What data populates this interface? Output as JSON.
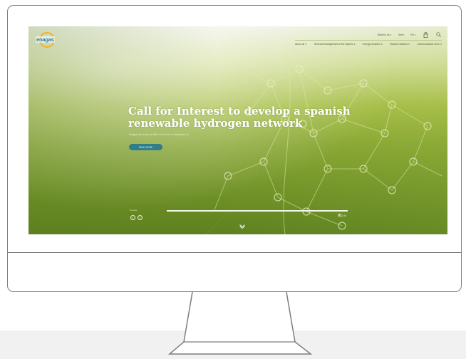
{
  "site": {
    "logo_text": "enagas"
  },
  "topbar": {
    "items": [
      "Work for Us ∨",
      "Get in",
      "EN ∨"
    ],
    "icons": [
      "user-icon",
      "search-icon"
    ]
  },
  "mainnav": {
    "items": [
      "About us ∨",
      "Technical Management of the System ∨",
      "Energy transition ∨",
      "Investor relations ∨",
      "Communication room ∨"
    ]
  },
  "hero": {
    "title": "Call for Interest to develop a spanish renewable hydrogen network",
    "subtitle": "Enagas will launch an NBO on the 2nd of September 2x",
    "button": "READ MORE"
  },
  "slider": {
    "label": "Enagas",
    "current": "01",
    "total": "/ 04"
  },
  "colors": {
    "hero_green": "#86a532",
    "button_teal": "#2f7e8a",
    "logo_blue": "#2a7fae",
    "logo_ring": "#f0b323"
  }
}
